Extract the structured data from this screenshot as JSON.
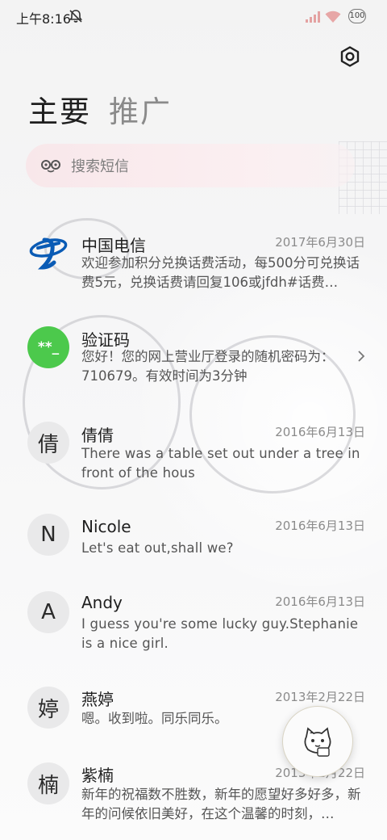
{
  "status_bar": {
    "time": "上午8:16",
    "battery": "100"
  },
  "tabs": [
    {
      "label": "主要"
    },
    {
      "label": "推广"
    }
  ],
  "search": {
    "placeholder": "搜索短信"
  },
  "messages": [
    {
      "avatar_text": "",
      "avatar_type": "china-telecom-logo",
      "sender": "中国电信",
      "date": "2017年6月30日",
      "snippet": "欢迎参加积分兑换话费活动，每500分可兑换话费5元，兑换话费请回复106或jfdh#话费…"
    },
    {
      "avatar_text": "**_",
      "avatar_type": "verification-code",
      "sender": "验证码",
      "date": "",
      "snippet": "您好！您的网上营业厅登录的随机密码为：710679。有效时间为3分钟"
    },
    {
      "avatar_text": "倩",
      "sender": "倩倩",
      "date": "2016年6月13日",
      "snippet": "There was a table set out under a tree in front of the hous"
    },
    {
      "avatar_text": "N",
      "sender": "Nicole",
      "date": "2016年6月13日",
      "snippet": "Let's eat out,shall we?"
    },
    {
      "avatar_text": "A",
      "sender": "Andy",
      "date": "2016年6月13日",
      "snippet": "I guess you're some lucky guy.Stephanie is a nice girl."
    },
    {
      "avatar_text": "婷",
      "sender": "燕婷",
      "date": "2013年2月22日",
      "snippet": "嗯。收到啦。同乐同乐。"
    },
    {
      "avatar_text": "楠",
      "sender": "紫楠",
      "date": "2013年2月22日",
      "snippet": "新年的祝福数不胜数，新年的愿望好多好多，新年的问候依旧美好，在这个温馨的时刻，…"
    }
  ],
  "colors": {
    "telecom_blue": "#0a5bb5",
    "verify_green": "#4cc94c",
    "search_pink": "#f8e7ea"
  }
}
